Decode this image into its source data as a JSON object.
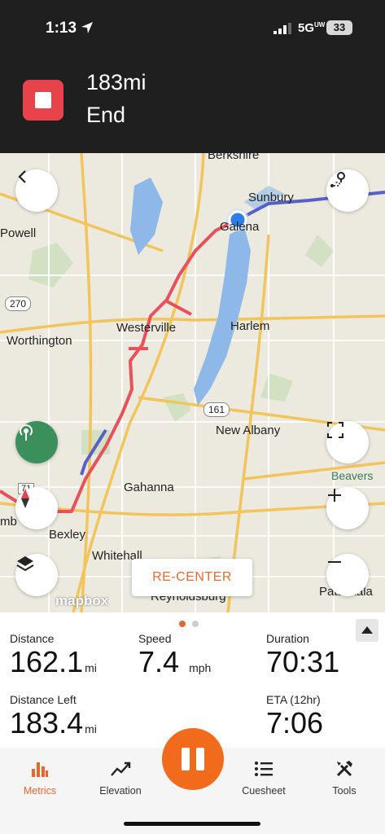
{
  "status_bar": {
    "time": "1:13",
    "network": "5G",
    "network_suffix": "UW",
    "battery": "33"
  },
  "header": {
    "distance": "183mi",
    "action": "End"
  },
  "map": {
    "labels": {
      "sunbury": "Sunbury",
      "galena": "Galena",
      "powell": "Powell",
      "route_270": "270",
      "worthington": "Worthington",
      "westerville": "Westerville",
      "harlem": "Harlem",
      "route_161": "161",
      "new_albany": "New Albany",
      "gahanna": "Gahanna",
      "bexley": "Bexley",
      "whitehall": "Whitehall",
      "reynoldsburg": "Reynoldsburg",
      "pataskala": "Pataskala",
      "beavers": "Beavers",
      "berkshire": "Berkshire",
      "route_71": "71",
      "columbus_partial": "mb"
    },
    "recenter_label": "RE-CENTER",
    "attribution": "mapbox",
    "colors": {
      "route": "#e8505b",
      "planned": "#5560c8",
      "water": "#7aaee0",
      "location": "#2b7ee6"
    }
  },
  "metrics": {
    "distance": {
      "label": "Distance",
      "value": "162.1",
      "unit": "mi"
    },
    "speed": {
      "label": "Speed",
      "value": "7.4",
      "unit": "mph"
    },
    "duration": {
      "label": "Duration",
      "value": "70:31"
    },
    "distance_left": {
      "label": "Distance Left",
      "value": "183.4",
      "unit": "mi"
    },
    "eta": {
      "label": "ETA (12hr)",
      "value": "7:06"
    }
  },
  "tabs": [
    {
      "label": "Metrics",
      "icon": "bar-chart-icon",
      "active": true
    },
    {
      "label": "Elevation",
      "icon": "trend-line-icon",
      "active": false
    },
    {
      "label": "Cuesheet",
      "icon": "list-icon",
      "active": false
    },
    {
      "label": "Tools",
      "icon": "tools-icon",
      "active": false
    }
  ]
}
